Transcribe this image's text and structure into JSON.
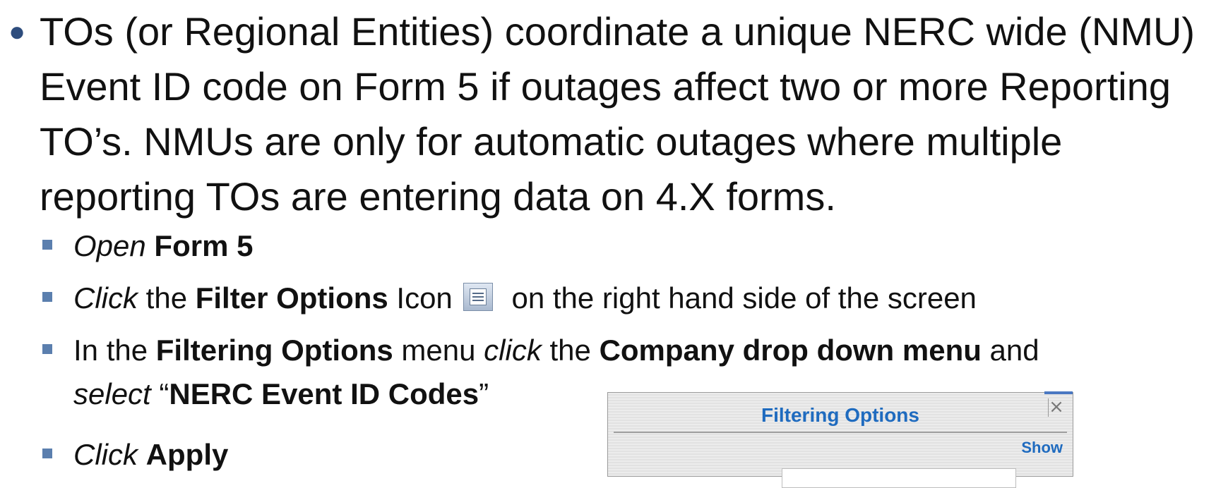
{
  "main_bullet": {
    "lines": [
      "TOs (or Regional Entities) coordinate a unique NERC wide (NMU)",
      "Event ID code on Form 5 if outages affect two or more Reporting",
      "TO’s. NMUs are only for automatic outages where multiple",
      "reporting TOs are entering data on 4.X forms."
    ]
  },
  "steps": {
    "open": {
      "verb": "Open",
      "target": "Form 5"
    },
    "click_filter": {
      "verb": "Click",
      "pre": " the ",
      "target": "Filter Options",
      "mid": " Icon",
      "post": "on the right hand side of the screen",
      "icon": "filter-options-icon"
    },
    "filtering": {
      "pre": "In the ",
      "menu": "Filtering Options",
      "mid1": " menu ",
      "verb": "click",
      "mid2": " the ",
      "target": "Company drop down menu",
      "post": " and",
      "verb2": "select",
      "open_quote": " “",
      "value": "NERC Event ID Codes",
      "close_quote": "”"
    },
    "apply": {
      "verb": "Click",
      "target": "Apply"
    }
  },
  "filtering_panel": {
    "title": "Filtering Options",
    "close": "×",
    "show": "Show"
  },
  "colors": {
    "bullet": "#2e4d7d",
    "sub_bullet": "#5b7fae",
    "panel_accent": "#1f6bbf"
  }
}
